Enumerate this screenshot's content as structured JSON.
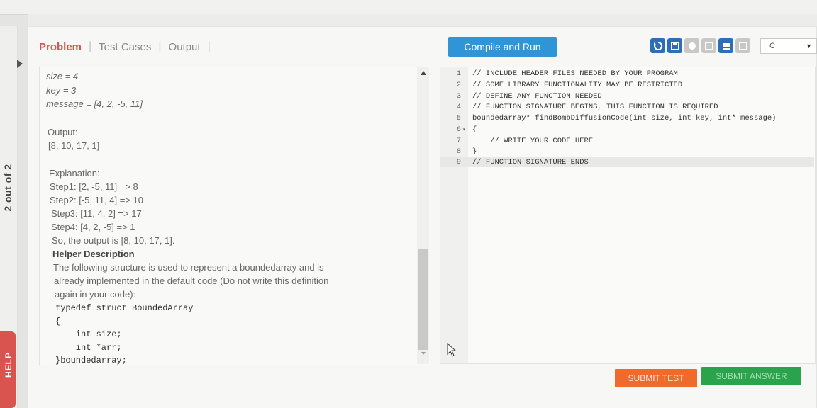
{
  "sidebar": {
    "question_counter": "2 out of 2",
    "help_label": "HELP"
  },
  "tabs": [
    {
      "label": "Problem"
    },
    {
      "label": "Test Cases"
    },
    {
      "label": "Output"
    }
  ],
  "toolbar": {
    "compile_label": "Compile and Run",
    "language": "C",
    "icons": [
      "reset-icon",
      "save-icon",
      "theme-icon",
      "layout-icon",
      "console-icon",
      "fullscreen-icon"
    ]
  },
  "problem": {
    "input_size": "size = 4",
    "input_key": "key = 3",
    "input_message": "message = [4, 2, -5, 11]",
    "output_heading": "Output:",
    "output_value": "[8, 10, 17, 1]",
    "explanation_heading": "Explanation:",
    "steps": [
      "Step1: [2, -5, 11] => 8",
      "Step2: [-5, 11, 4] => 10",
      "Step3: [11, 4, 2] => 17",
      "Step4: [4, 2, -5] => 1"
    ],
    "conclusion": "So, the output is [8, 10, 17, 1].",
    "helper_heading": "Helper Description",
    "helper_text": [
      "The following structure is used to represent a boundedarray and is",
      "already implemented in the default code (Do not write this definition",
      "again in your code):"
    ],
    "struct_lines": [
      "typedef struct BoundedArray",
      "{",
      "    int size;",
      "    int *arr;",
      "}boundedarray;"
    ]
  },
  "editor": {
    "lines": [
      {
        "n": "1",
        "fold": "",
        "text": "// INCLUDE HEADER FILES NEEDED BY YOUR PROGRAM"
      },
      {
        "n": "2",
        "fold": "",
        "text": "// SOME LIBRARY FUNCTIONALITY MAY BE RESTRICTED"
      },
      {
        "n": "3",
        "fold": "",
        "text": "// DEFINE ANY FUNCTION NEEDED"
      },
      {
        "n": "4",
        "fold": "",
        "text": "// FUNCTION SIGNATURE BEGINS, THIS FUNCTION IS REQUIRED"
      },
      {
        "n": "5",
        "fold": "",
        "text": "boundedarray* findBombDiffusionCode(int size, int key, int* message)"
      },
      {
        "n": "6",
        "fold": "▾",
        "text": "{"
      },
      {
        "n": "7",
        "fold": "",
        "text": "    // WRITE YOUR CODE HERE"
      },
      {
        "n": "8",
        "fold": "",
        "text": "}"
      },
      {
        "n": "9",
        "fold": "",
        "text": "// FUNCTION SIGNATURE ENDS"
      }
    ]
  },
  "footer": {
    "submit_test": "SUBMIT TEST",
    "submit_answer": "SUBMIT ANSWER"
  }
}
